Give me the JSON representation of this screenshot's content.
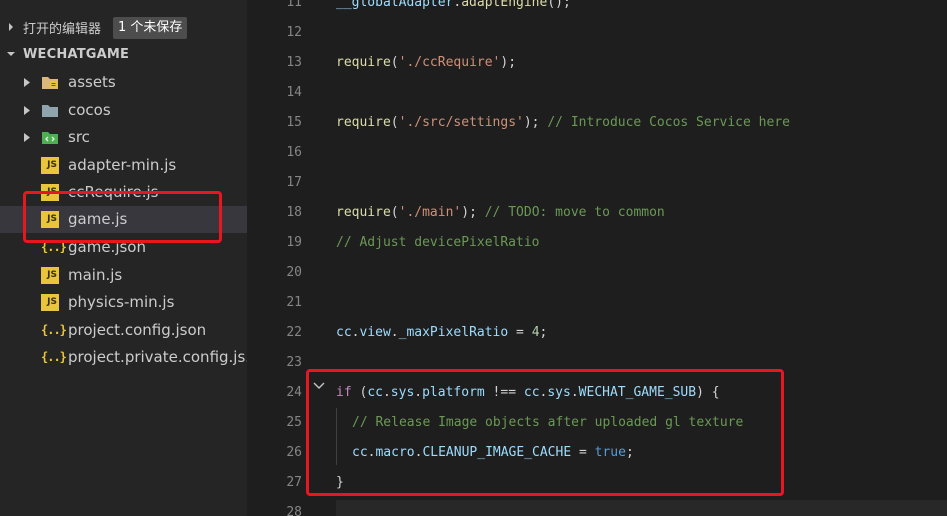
{
  "sidebar": {
    "open_editors_title": "打开的编辑器",
    "unsaved_badge": "1 个未保存",
    "root_title": "WECHATGAME",
    "items": [
      {
        "label": "assets",
        "icon": "assets-folder-icon"
      },
      {
        "label": "cocos",
        "icon": "folder-icon"
      },
      {
        "label": "src",
        "icon": "src-folder-icon"
      },
      {
        "label": "adapter-min.js",
        "icon": "js-file-icon"
      },
      {
        "label": "ccRequire.js",
        "icon": "js-file-icon"
      },
      {
        "label": "game.js",
        "icon": "js-file-icon",
        "selected": true
      },
      {
        "label": "game.json",
        "icon": "json-file-icon"
      },
      {
        "label": "main.js",
        "icon": "js-file-icon"
      },
      {
        "label": "physics-min.js",
        "icon": "js-file-icon"
      },
      {
        "label": "project.config.json",
        "icon": "json-file-icon"
      },
      {
        "label": "project.private.config.js...",
        "icon": "json-file-icon"
      }
    ],
    "js_badge_text": "JS",
    "json_badge_text": "{..}"
  },
  "editor": {
    "line_numbers": [
      "11",
      "12",
      "13",
      "14",
      "15",
      "16",
      "17",
      "18",
      "19",
      "20",
      "21",
      "22",
      "23",
      "24",
      "25",
      "26",
      "27",
      "28"
    ],
    "lines": {
      "l11": {
        "a": "__globalAdapter",
        "b": ".",
        "c": "adaptEngine",
        "d": "();"
      },
      "l13": {
        "a": "require",
        "b": "(",
        "c": "'./ccRequire'",
        "d": ");"
      },
      "l15": {
        "a": "require",
        "b": "(",
        "c": "'./src/settings'",
        "d": "); ",
        "e": "// Introduce Cocos Service here"
      },
      "l18": {
        "a": "require",
        "b": "(",
        "c": "'./main'",
        "d": "); ",
        "e": "// TODO: move to common"
      },
      "l19": {
        "a": "// Adjust devicePixelRatio"
      },
      "l22": {
        "a": "cc",
        "b": ".",
        "c": "view",
        "d": ".",
        "e": "_maxPixelRatio",
        "f": " = ",
        "g": "4",
        "h": ";"
      },
      "l24": {
        "a": "if",
        "b": " (",
        "c": "cc",
        "d": ".",
        "e": "sys",
        "f": ".",
        "g": "platform",
        "h": " !== ",
        "i": "cc",
        "j": ".",
        "k": "sys",
        "l": ".",
        "m": "WECHAT_GAME_SUB",
        "n": ") {"
      },
      "l25": {
        "a": "// Release Image objects after uploaded gl texture"
      },
      "l26": {
        "a": "cc",
        "b": ".",
        "c": "macro",
        "d": ".",
        "e": "CLEANUP_IMAGE_CACHE",
        "f": " = ",
        "g": "true",
        "h": ";"
      },
      "l27": {
        "a": "}"
      }
    }
  },
  "colors": {
    "highlight_box": "#e8171f",
    "sidebar_bg": "#252526",
    "editor_bg": "#1e1e1e"
  }
}
